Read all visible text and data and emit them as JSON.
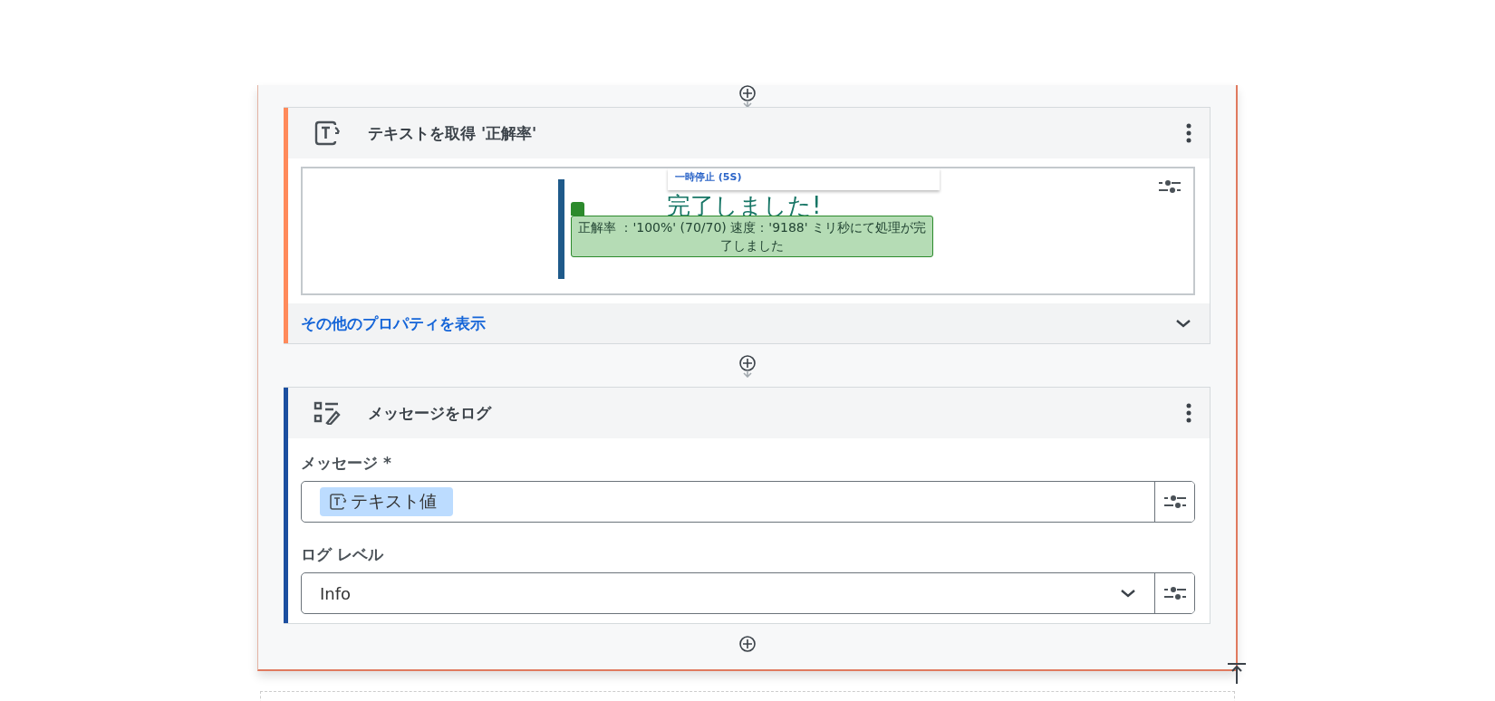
{
  "steps": [
    {
      "kind": "get_text",
      "title": "テキストを取得 '正解率'",
      "color": "#ff8a5b",
      "preview": {
        "toolbar_label": "一時停止 (5S)",
        "heading": "完了しました!",
        "highlight_text": "正解率 ：'100%' (70/70) 速度：'9188' ミリ秒にて処理が完了しました"
      },
      "more_link": "その他のプロパティを表示",
      "expanded": false
    },
    {
      "kind": "log_message",
      "title": "メッセージをログ",
      "color": "#1c4fa0",
      "fields": [
        {
          "kind": "token",
          "label": "メッセージ *",
          "token": "テキスト値"
        },
        {
          "kind": "select",
          "label": "ログ レベル",
          "value": "Info"
        }
      ]
    }
  ]
}
